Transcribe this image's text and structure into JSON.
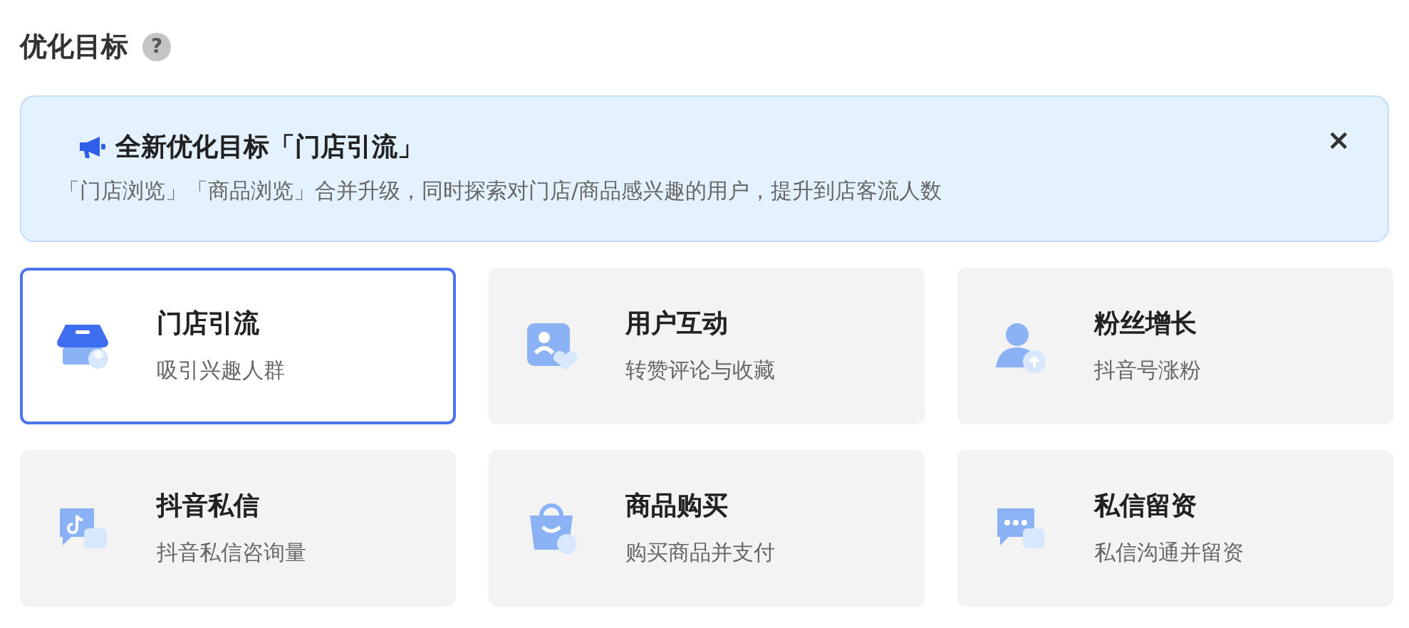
{
  "section": {
    "title": "优化目标",
    "help_icon": "?"
  },
  "notice": {
    "title": "全新优化目标「门店引流」",
    "text": "「门店浏览」「商品浏览」合并升级，同时探索对门店/商品感兴趣的用户，提升到店客流人数",
    "close": "×"
  },
  "goals": [
    {
      "kind": "store",
      "title": "门店引流",
      "subtitle": "吸引兴趣人群",
      "selected": true
    },
    {
      "kind": "interact",
      "title": "用户互动",
      "subtitle": "转赞评论与收藏",
      "selected": false
    },
    {
      "kind": "fans",
      "title": "粉丝增长",
      "subtitle": "抖音号涨粉",
      "selected": false
    },
    {
      "kind": "message",
      "title": "抖音私信",
      "subtitle": "抖音私信咨询量",
      "selected": false
    },
    {
      "kind": "shop",
      "title": "商品购买",
      "subtitle": "购买商品并支付",
      "selected": false
    },
    {
      "kind": "lead",
      "title": "私信留资",
      "subtitle": "私信沟通并留资",
      "selected": false
    }
  ]
}
